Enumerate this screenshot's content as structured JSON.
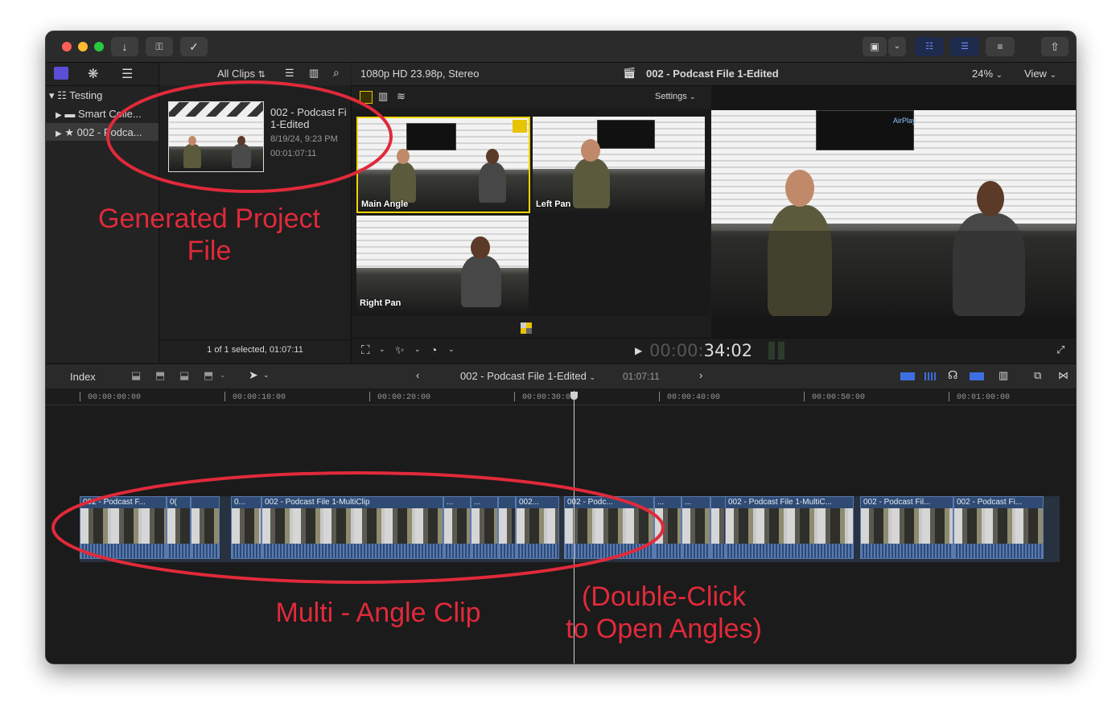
{
  "toolbar": {
    "colors": {
      "close": "#ff5f57",
      "minimize": "#febc2e",
      "zoom": "#28c840"
    },
    "left_icons": [
      "import-icon",
      "keyword-icon",
      "checkmark-icon"
    ],
    "right_icons": [
      "viewer-display-icon",
      "chevron-down-icon",
      "browser-toggle-icon",
      "timeline-toggle-icon",
      "inspector-toggle-icon",
      "share-icon"
    ]
  },
  "library": {
    "items": [
      {
        "label": "Testing"
      },
      {
        "label": "Smart Colle..."
      },
      {
        "label": "002 - Podca..."
      }
    ]
  },
  "browser": {
    "filter": "All Clips",
    "clip": {
      "name_line1": "002 - Podcast Fi",
      "name_line2": "1-Edited",
      "date": "8/19/24, 9:23 PM",
      "duration": "00:01:07:11"
    },
    "status": "1 of 1 selected, 01:07:11"
  },
  "viewer": {
    "format": "1080p HD 23.98p, Stereo",
    "title": "002 - Podcast File 1-Edited",
    "zoom": "24%",
    "view_label": "View",
    "settings_label": "Settings",
    "airplay": "AirPlay",
    "timecode_dim": "00:00:",
    "timecode": "34:02"
  },
  "angles": [
    {
      "label": "Main Angle",
      "active": true
    },
    {
      "label": "Left Pan",
      "active": false
    },
    {
      "label": "Right Pan",
      "active": false
    }
  ],
  "timeline": {
    "index_label": "Index",
    "title": "002 - Podcast File 1-Edited",
    "duration": "01:07:11",
    "ruler": [
      "00:00:00:00",
      "00:00:10:00",
      "00:00:20:00",
      "00:00:30:00",
      "00:00:40:00",
      "00:00:50:00",
      "00:01:00:00"
    ],
    "clips": [
      {
        "label": "002 - Podcast F..."
      },
      {
        "label": "0("
      },
      {
        "label": ""
      },
      {
        "label": "0..."
      },
      {
        "label": "002 - Podcast File 1-MultiClip"
      },
      {
        "label": "..."
      },
      {
        "label": "..."
      },
      {
        "label": ""
      },
      {
        "label": "002..."
      },
      {
        "label": "002 - Podc..."
      },
      {
        "label": "..."
      },
      {
        "label": "..."
      },
      {
        "label": ""
      },
      {
        "label": "002 - Podcast File 1-MultiC..."
      },
      {
        "label": "002 - Podcast Fil..."
      },
      {
        "label": "002 - Podcast Fi..."
      }
    ]
  },
  "annotations": {
    "project_line1": "Generated Project",
    "project_line2": "File",
    "multi": "Multi - Angle Clip",
    "dbl_line1": "(Double-Click",
    "dbl_line2": "to Open Angles)",
    "color": "#e02a3a"
  }
}
